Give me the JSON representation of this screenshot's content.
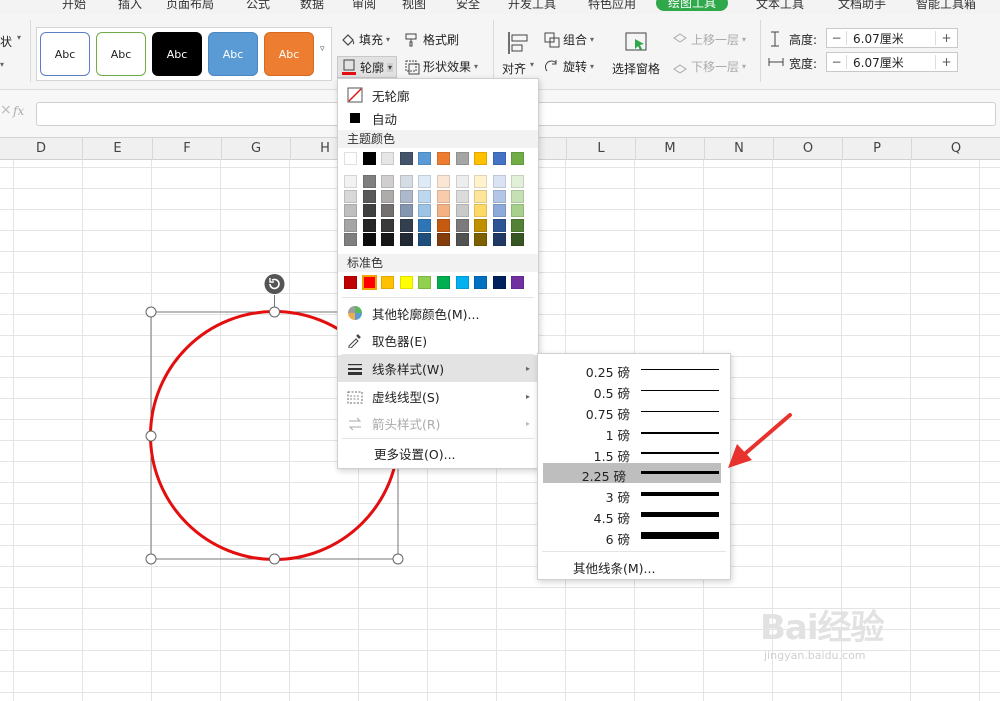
{
  "tabs": [
    "开始",
    "插入",
    "页面布局",
    "公式",
    "数据",
    "审阅",
    "视图",
    "安全",
    "开发工具",
    "特色应用",
    "绘图工具",
    "文本工具",
    "文档助手",
    "智能工具箱"
  ],
  "ribbon": {
    "left_partial": "状",
    "style_label": "Abc",
    "fill": "填充",
    "format_painter": "格式刷",
    "outline": "轮廓",
    "shape_effects": "形状效果",
    "group": "组合",
    "bring_forward": "上移一层",
    "align": "对齐",
    "rotate": "旋转",
    "selection_pane": "选择窗格",
    "send_backward": "下移一层",
    "height_label": "高度:",
    "height_value": "6.07厘米",
    "width_label": "宽度:",
    "width_value": "6.07厘米",
    "minus": "−",
    "plus": "+"
  },
  "formula_bar": {
    "fx": "fx"
  },
  "columns": [
    "D",
    "E",
    "F",
    "G",
    "H",
    "",
    "",
    "",
    "L",
    "M",
    "N",
    "O",
    "P",
    "Q"
  ],
  "outline_menu": {
    "no_outline": "无轮廓",
    "auto": "自动",
    "theme_colors": "主题颜色",
    "standard_colors": "标准色",
    "more_colors": "其他轮廓颜色(M)...",
    "eyedropper": "取色器(E)",
    "line_style": "线条样式(W)",
    "dash_type": "虚线线型(S)",
    "arrow_style": "箭头样式(R)",
    "more_settings": "更多设置(O)..."
  },
  "line_weights": [
    "0.25 磅",
    "0.5 磅",
    "0.75 磅",
    "1 磅",
    "1.5 磅",
    "2.25 磅",
    "3 磅",
    "4.5 磅",
    "6 磅"
  ],
  "line_weight_selected": "2.25 磅",
  "other_lines": "其他线条(M)...",
  "watermark": {
    "text": "Bai经验",
    "url": "jingyan.baidu.com"
  },
  "colors": {
    "accent_green": "#2ea84a",
    "shape_outline": "#e30f0f",
    "arrow": "#e8322d",
    "theme_top": [
      "#ffffff",
      "#000000",
      "#e7e6e6",
      "#44546a",
      "#5b9bd5",
      "#ed7d31",
      "#a5a5a5",
      "#ffc000",
      "#4472c4",
      "#70ad47"
    ],
    "theme_shades": [
      [
        "#f2f2f2",
        "#7f7f7f",
        "#d0cece",
        "#d6dce4",
        "#deebf6",
        "#fbe5d5",
        "#ededed",
        "#fff2cc",
        "#dae3f3",
        "#e2efd9"
      ],
      [
        "#d8d8d8",
        "#595959",
        "#aeabab",
        "#adb9ca",
        "#bdd7ee",
        "#f7cbac",
        "#dbdbdb",
        "#fee599",
        "#b4c6e7",
        "#c5e0b3"
      ],
      [
        "#bfbfbf",
        "#3f3f3f",
        "#757070",
        "#8496b0",
        "#9dc3e6",
        "#f4b183",
        "#c9c9c9",
        "#ffd965",
        "#8eaadb",
        "#a8d08d"
      ],
      [
        "#a5a5a5",
        "#262626",
        "#3a3838",
        "#323f4f",
        "#2e75b5",
        "#c55a11",
        "#7b7b7b",
        "#bf9000",
        "#2f5496",
        "#538135"
      ],
      [
        "#7f7f7f",
        "#0c0c0c",
        "#171616",
        "#222a35",
        "#1e4e79",
        "#833c0b",
        "#525252",
        "#7f6000",
        "#1f3864",
        "#375623"
      ]
    ],
    "standard": [
      "#c00000",
      "#ff0000",
      "#ffc000",
      "#ffff00",
      "#92d050",
      "#00b050",
      "#00b0f0",
      "#0070c0",
      "#002060",
      "#7030a0"
    ]
  }
}
